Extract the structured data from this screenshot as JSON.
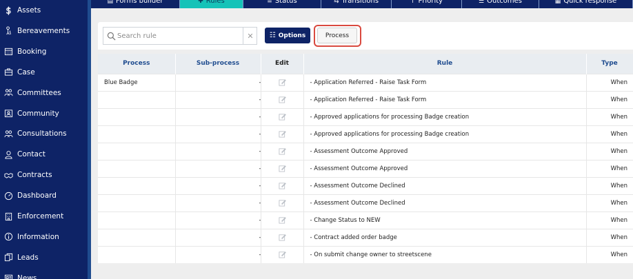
{
  "sidebar": {
    "items": [
      {
        "label": "Assets",
        "icon": "dollar-icon"
      },
      {
        "label": "Bereavements",
        "icon": "person-cane-icon"
      },
      {
        "label": "Booking",
        "icon": "calendar-icon"
      },
      {
        "label": "Case",
        "icon": "briefcase-icon"
      },
      {
        "label": "Committees",
        "icon": "users-icon"
      },
      {
        "label": "Community",
        "icon": "community-icon"
      },
      {
        "label": "Consultations",
        "icon": "users-icon"
      },
      {
        "label": "Contact",
        "icon": "user-icon"
      },
      {
        "label": "Contracts",
        "icon": "handshake-icon"
      },
      {
        "label": "Dashboard",
        "icon": "gauge-icon"
      },
      {
        "label": "Enforcement",
        "icon": "building-icon"
      },
      {
        "label": "Information",
        "icon": "info-icon"
      },
      {
        "label": "Leads",
        "icon": "copy-icon"
      },
      {
        "label": "News",
        "icon": "newspaper-icon"
      }
    ]
  },
  "tabs": [
    {
      "label": "Forms builder",
      "active": false
    },
    {
      "label": "Rules",
      "active": true
    },
    {
      "label": "Status",
      "active": false
    },
    {
      "label": "Transitions",
      "active": false
    },
    {
      "label": "Priority",
      "active": false
    },
    {
      "label": "Outcomes",
      "active": false
    },
    {
      "label": "Quick response",
      "active": false
    }
  ],
  "toolbar": {
    "search_placeholder": "Search rule",
    "search_value": "",
    "clear_label": "✕",
    "options_label": "Options",
    "process_label": "Process"
  },
  "table": {
    "headers": {
      "process": "Process",
      "subprocess": "Sub-process",
      "edit": "Edit",
      "rule": "Rule",
      "type": "Type"
    },
    "rows": [
      {
        "process": "Blue Badge",
        "subprocess": "-",
        "rule": "- Application Referred - Raise Task Form",
        "type": "When"
      },
      {
        "process": "",
        "subprocess": "-",
        "rule": "- Application Referred - Raise Task Form",
        "type": "When"
      },
      {
        "process": "",
        "subprocess": "-",
        "rule": "- Approved applications for processing Badge creation",
        "type": "When"
      },
      {
        "process": "",
        "subprocess": "-",
        "rule": "- Approved applications for processing Badge creation",
        "type": "When"
      },
      {
        "process": "",
        "subprocess": "-",
        "rule": "- Assessment Outcome Approved",
        "type": "When"
      },
      {
        "process": "",
        "subprocess": "-",
        "rule": "- Assessment Outcome Approved",
        "type": "When"
      },
      {
        "process": "",
        "subprocess": "-",
        "rule": "- Assessment Outcome Declined",
        "type": "When"
      },
      {
        "process": "",
        "subprocess": "-",
        "rule": "- Assessment Outcome Declined",
        "type": "When"
      },
      {
        "process": "",
        "subprocess": "-",
        "rule": "- Change Status to NEW",
        "type": "When"
      },
      {
        "process": "",
        "subprocess": "-",
        "rule": "- Contract added order badge",
        "type": "When"
      },
      {
        "process": "",
        "subprocess": "-",
        "rule": "- On submit change owner to streetscene",
        "type": "When"
      }
    ]
  },
  "colors": {
    "sidebar": "#0e2366",
    "active_tab": "#16c3b8",
    "highlight": "#d9493f",
    "header_text": "#1f4c8f"
  }
}
